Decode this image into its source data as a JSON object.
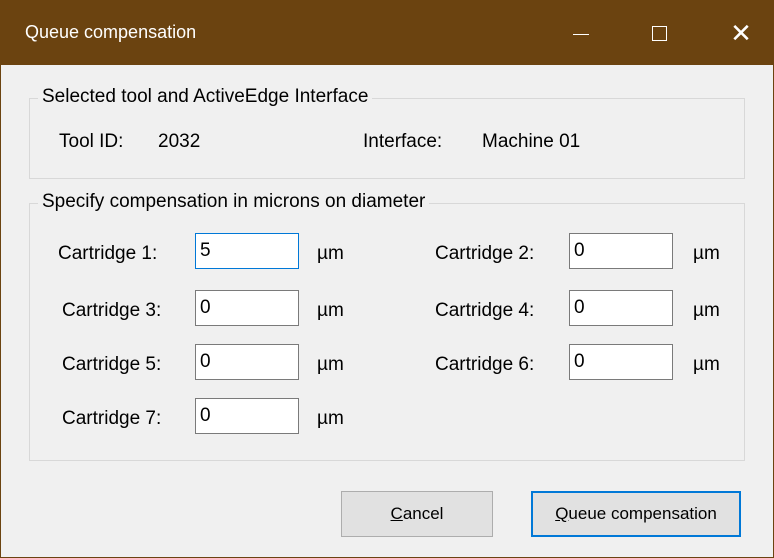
{
  "window": {
    "title": "Queue compensation",
    "minimize_glyph": "—",
    "maximize_glyph": "☐",
    "close_glyph": "✕",
    "titlebar_color": "#6b4310"
  },
  "selection_group": {
    "legend": "Selected tool and ActiveEdge Interface",
    "tool_id_label": "Tool ID:",
    "tool_id_value": "2032",
    "interface_label": "Interface:",
    "interface_value": "Machine 01"
  },
  "compensation_group": {
    "legend": "Specify compensation in microns on diameter",
    "unit": "µm",
    "cartridges": [
      {
        "label": "Cartridge 1:",
        "value": "5"
      },
      {
        "label": "Cartridge 2:",
        "value": "0"
      },
      {
        "label": "Cartridge 3:",
        "value": "0"
      },
      {
        "label": "Cartridge 4:",
        "value": "0"
      },
      {
        "label": "Cartridge 5:",
        "value": "0"
      },
      {
        "label": "Cartridge 6:",
        "value": "0"
      },
      {
        "label": "Cartridge 7:",
        "value": "0"
      }
    ]
  },
  "buttons": {
    "cancel_first": "C",
    "cancel_rest": "ancel",
    "queue_first": "Q",
    "queue_rest": "ueue compensation"
  },
  "colors": {
    "accent": "#0078d7"
  }
}
